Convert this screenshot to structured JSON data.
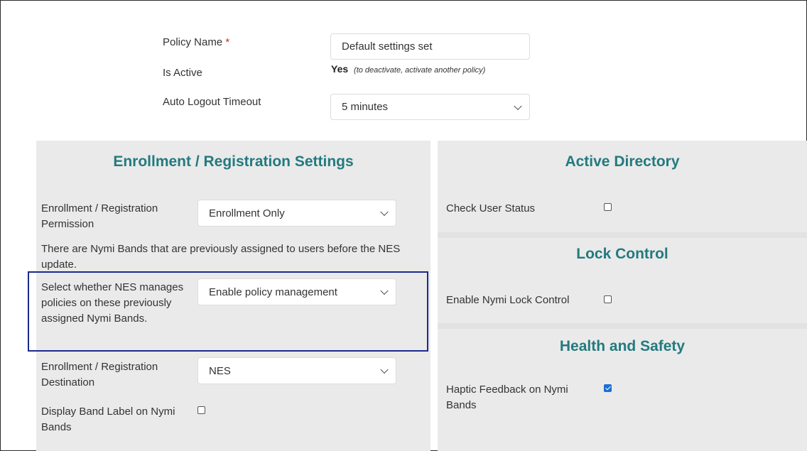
{
  "policy": {
    "name_label": "Policy Name",
    "required_mark": "*",
    "name_value": "Default settings set",
    "active_label": "Is Active",
    "active_value": "Yes",
    "active_note": "(to deactivate, activate another policy)",
    "timeout_label": "Auto Logout Timeout",
    "timeout_value": "5 minutes"
  },
  "enrollment": {
    "heading": "Enrollment / Registration Settings",
    "permission_label": "Enrollment / Registration Permission",
    "permission_value": "Enrollment Only",
    "notice": "There are Nymi Bands that are previously assigned to users before the NES update.",
    "manage_label": "Select whether NES manages policies on these previously assigned Nymi Bands.",
    "manage_value": "Enable policy management",
    "destination_label": "Enrollment / Registration Destination",
    "destination_value": "NES",
    "band_label_label": "Display Band Label on Nymi Bands",
    "band_label_checked": false
  },
  "active_directory": {
    "heading": "Active Directory",
    "check_user_label": "Check User Status",
    "check_user_checked": false
  },
  "lock_control": {
    "heading": "Lock Control",
    "enable_label": "Enable Nymi Lock Control",
    "enable_checked": false
  },
  "health_safety": {
    "heading": "Health and Safety",
    "haptic_label": "Haptic Feedback on Nymi Bands",
    "haptic_checked": true
  },
  "colors": {
    "heading": "#237a7e",
    "highlight_border": "#1b2a8c",
    "panel_bg": "#eaeaea",
    "checkbox_on": "#1a6fd6"
  }
}
